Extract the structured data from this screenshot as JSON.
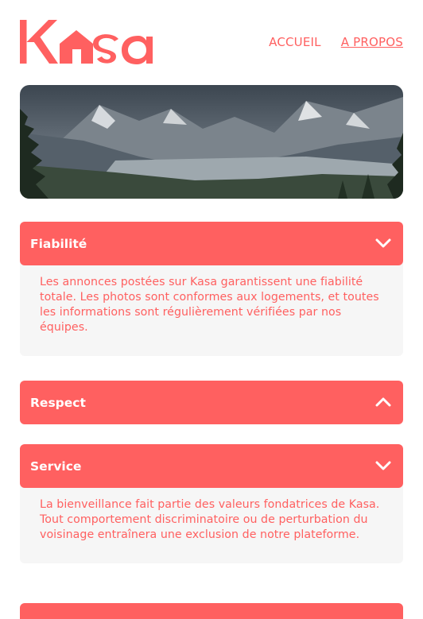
{
  "brand": {
    "name": "Kasa",
    "color": "#ff6060"
  },
  "nav": {
    "items": [
      {
        "label": "ACCUEIL",
        "active": false
      },
      {
        "label": "A PROPOS",
        "active": true
      }
    ]
  },
  "banner": {
    "image": "mountain-valley-landscape"
  },
  "accordions": [
    {
      "title": "Fiabilité",
      "open": true,
      "icon": "chevron-down-icon",
      "text": "Les annonces postées sur Kasa garantissent une fiabilité totale. Les photos sont conformes aux logements, et toutes les informations sont régulièrement vérifiées par nos équipes."
    },
    {
      "title": "Respect",
      "open": false,
      "icon": "chevron-up-icon",
      "text": ""
    },
    {
      "title": "Service",
      "open": true,
      "icon": "chevron-down-icon",
      "text": "La bienveillance fait partie des valeurs fondatrices de Kasa. Tout comportement discriminatoire ou de perturbation du voisinage entraînera une exclusion de notre plateforme."
    }
  ]
}
